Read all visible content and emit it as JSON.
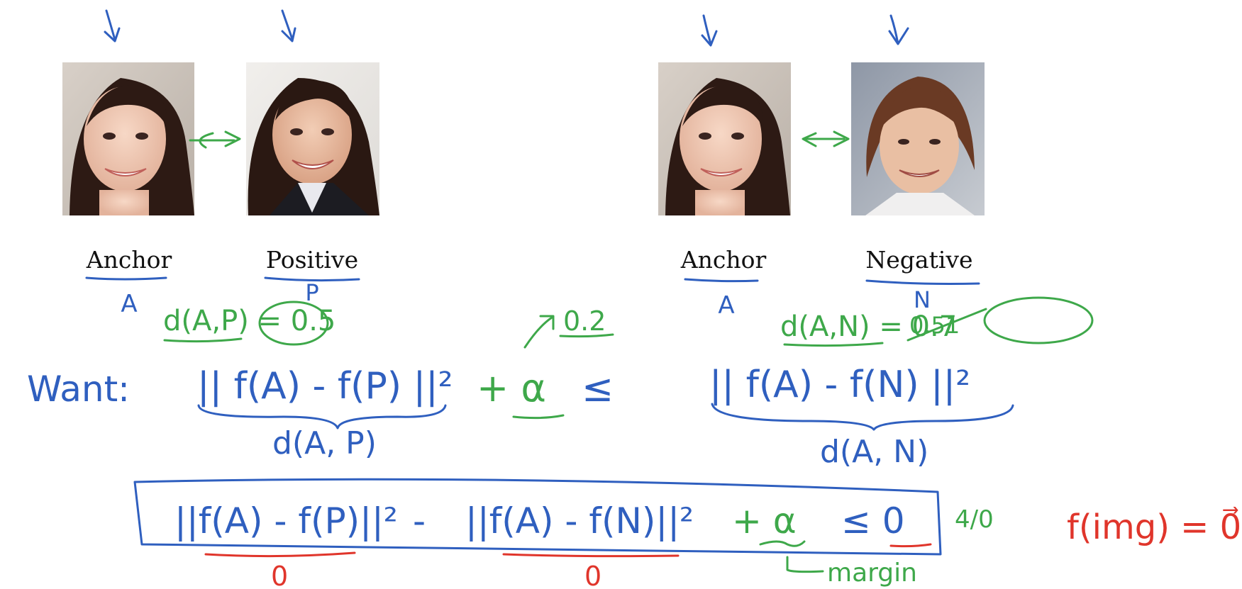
{
  "colors": {
    "ink_blue": "#2f5fbf",
    "ink_green": "#3ea84a",
    "ink_red": "#e0352b",
    "label_black": "#111111"
  },
  "photos": [
    {
      "label": "Anchor",
      "symbol": "A"
    },
    {
      "label": "Positive",
      "symbol": "P"
    },
    {
      "label": "Anchor",
      "symbol": "A"
    },
    {
      "label": "Negative",
      "symbol": "N"
    }
  ],
  "notes": {
    "d_ap_value": "d(A,P) = 0.5",
    "alpha_value": "0.2",
    "d_an_crossed": "0.51",
    "d_an_value": "d(A,N) = 0.7",
    "want": "Want:",
    "want_lhs": "|| f(A) - f(P) ||²",
    "plus_alpha": "+ α",
    "leq": "≤",
    "want_rhs": "|| f(A) - f(N) ||²",
    "under_lhs": "d(A, P)",
    "under_rhs": "d(A, N)",
    "boxed_part1": "||f(A) - f(P)||²",
    "minus": "-",
    "boxed_part2": "||f(A) - f(N)||²",
    "boxed_alpha": "+ α",
    "boxed_leq_zero": "≤ 0",
    "side_mark": "4/0",
    "zero_1": "0",
    "zero_2": "0",
    "margin": "margin",
    "f_img": "f(img) = 0⃗"
  }
}
